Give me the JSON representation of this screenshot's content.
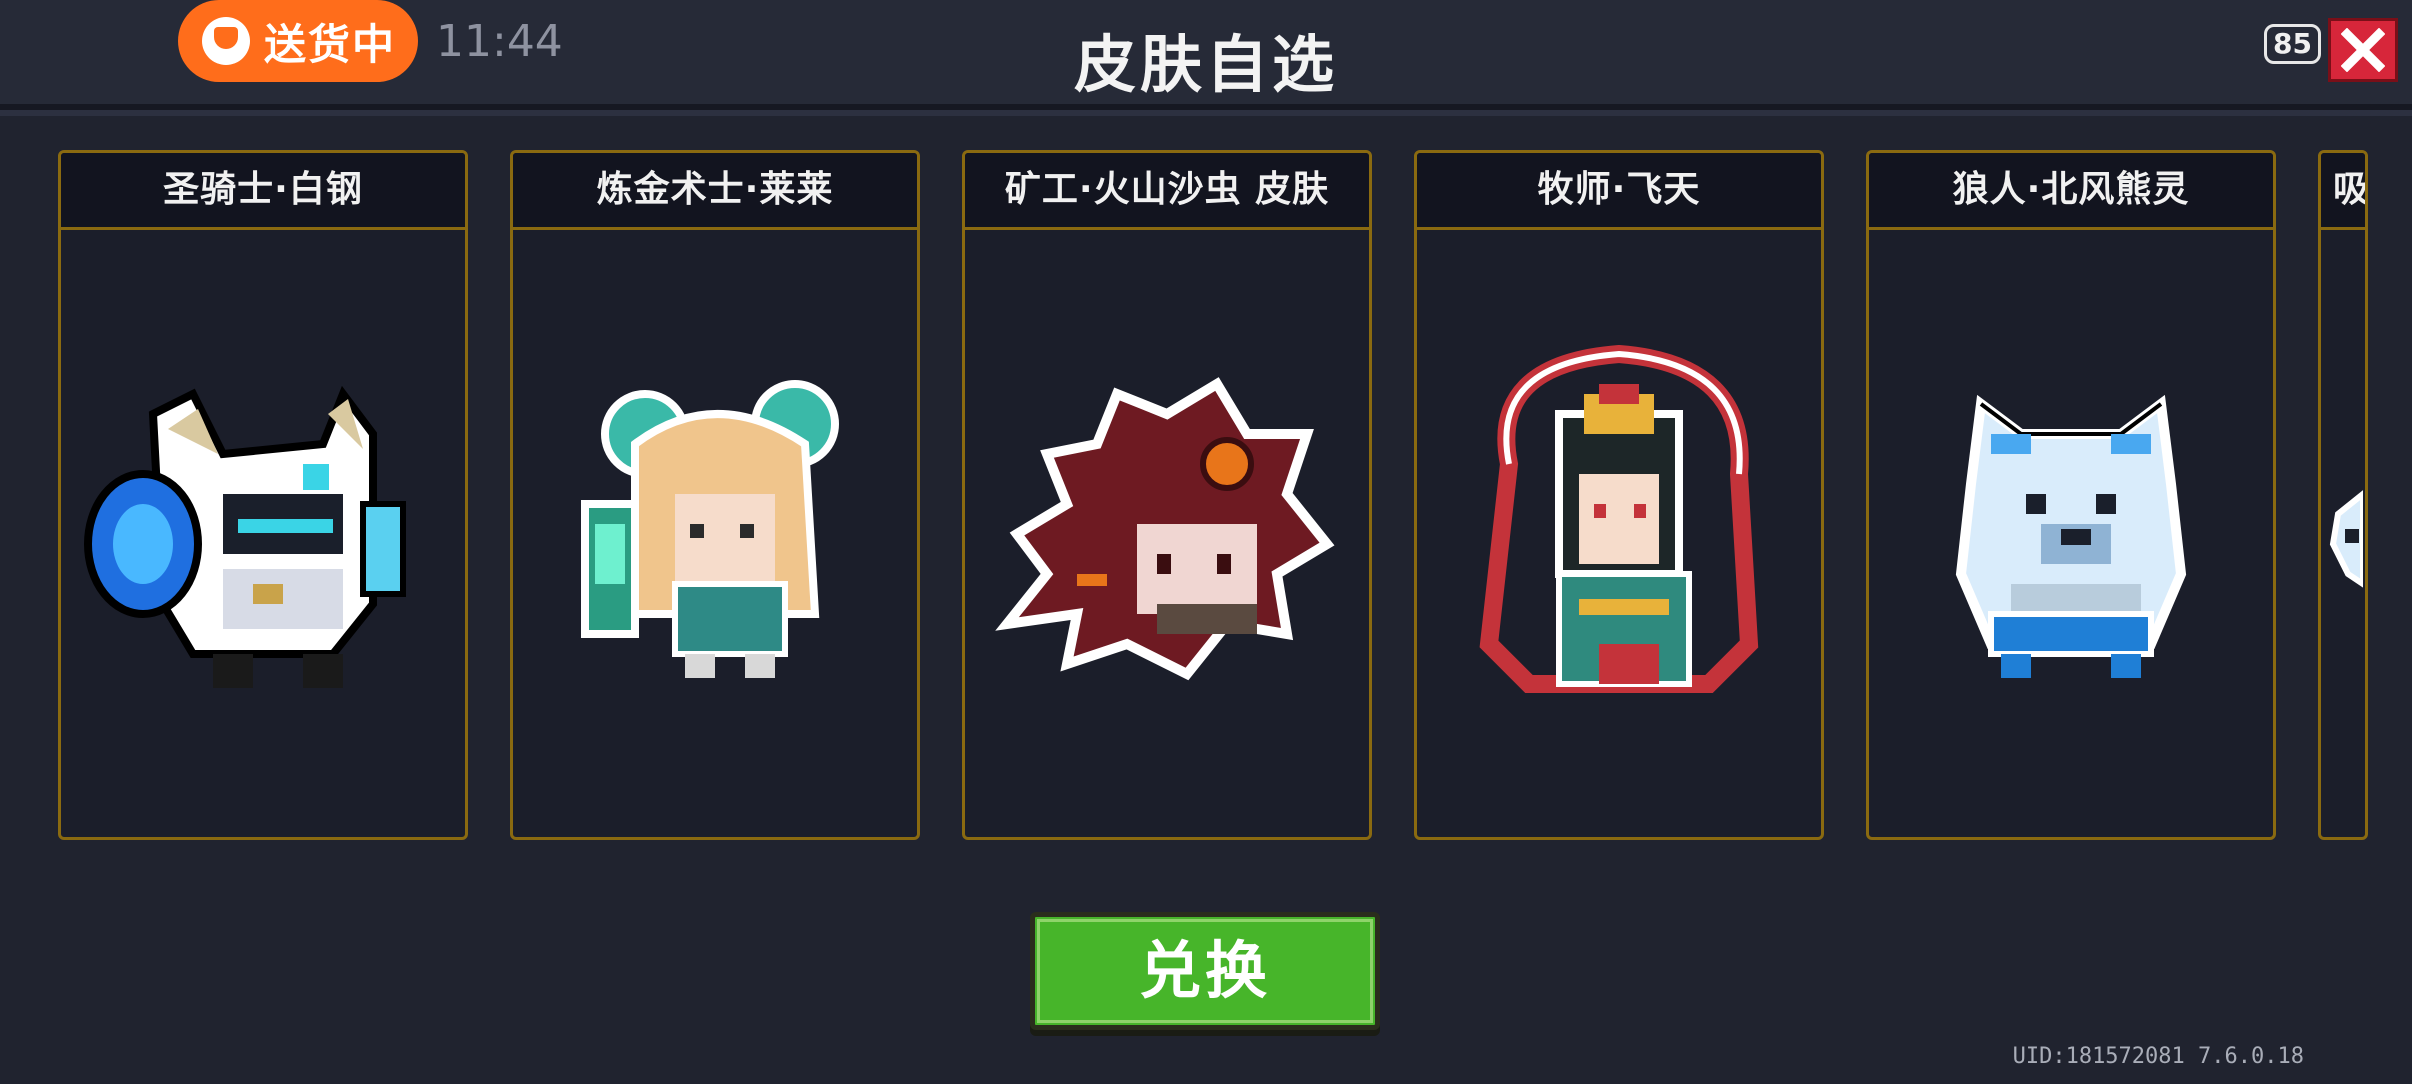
{
  "status_pill": {
    "label": "送货中"
  },
  "clock": "11:44",
  "title": "皮肤自选",
  "fps": "85",
  "cards": [
    {
      "label": "圣骑士·白钢"
    },
    {
      "label": "炼金术士·莱莱"
    },
    {
      "label": "矿工·火山沙虫 皮肤"
    },
    {
      "label": "牧师·飞天"
    },
    {
      "label": "狼人·北风熊灵"
    },
    {
      "label": "吸"
    }
  ],
  "redeem_label": "兑换",
  "footer": {
    "uid": "UID:181572081 7.6.0.18"
  },
  "colors": {
    "accent_orange": "#ff6d1b",
    "close_red": "#d7263a",
    "card_border_gold": "#8a6a10",
    "button_green": "#47b52a",
    "background": "#20232f"
  }
}
